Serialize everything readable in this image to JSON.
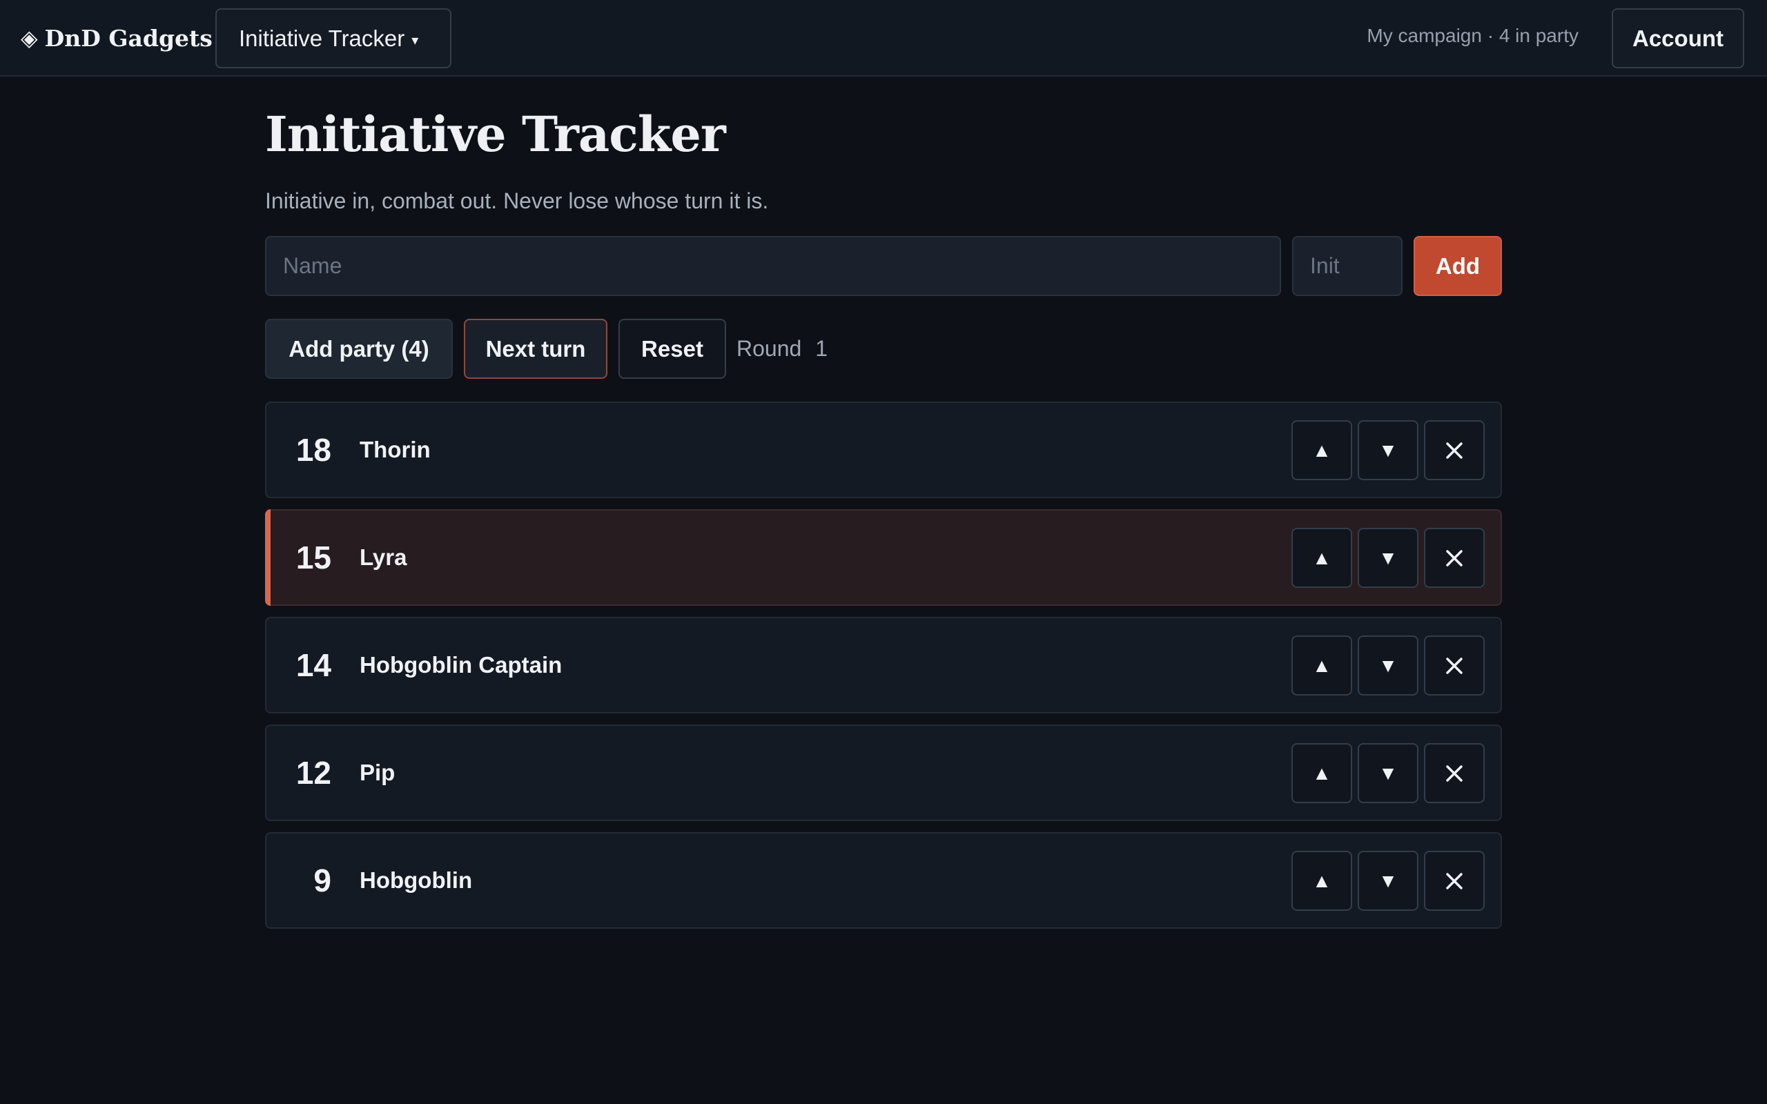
{
  "header": {
    "brand_icon": "◈",
    "brand": "DnD Gadgets",
    "tool_menu_label": "Initiative Tracker",
    "tool_menu_caret": "▾",
    "campaign_info": "My campaign · 4 in party",
    "account_label": "Account"
  },
  "page": {
    "title": "Initiative Tracker",
    "subtitle": "Initiative in, combat out. Never lose whose turn it is."
  },
  "form": {
    "name_placeholder": "Name",
    "init_placeholder": "Init",
    "add_label": "Add"
  },
  "controls": {
    "add_party_label": "Add party (4)",
    "next_turn_label": "Next turn",
    "reset_label": "Reset",
    "round_label": "Round",
    "round_value": "1"
  },
  "combatants": [
    {
      "init": "18",
      "name": "Thorin",
      "active": false
    },
    {
      "init": "15",
      "name": "Lyra",
      "active": true
    },
    {
      "init": "14",
      "name": "Hobgoblin Captain",
      "active": false
    },
    {
      "init": "12",
      "name": "Pip",
      "active": false
    },
    {
      "init": "9",
      "name": "Hobgoblin",
      "active": false
    }
  ],
  "row_controls": {
    "up_icon": "▲",
    "down_icon": "▼"
  },
  "colors": {
    "accent": "#c0492f",
    "active_marker": "#d8674d",
    "background": "#0d1117"
  }
}
